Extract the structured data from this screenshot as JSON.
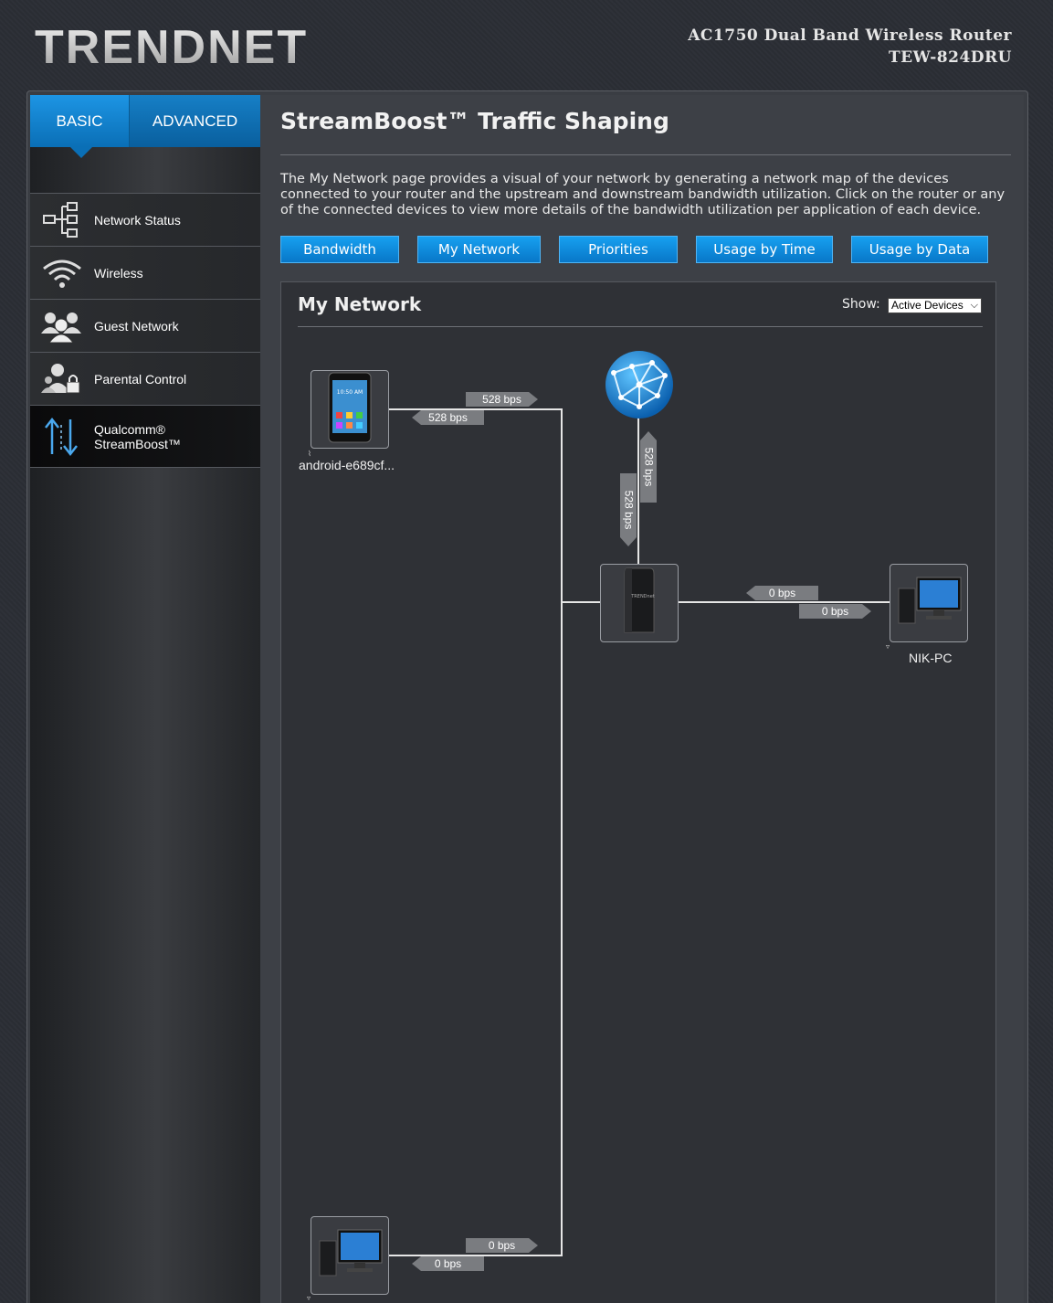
{
  "header": {
    "logo": "TRENDNET",
    "product_name": "AC1750 Dual Band Wireless Router",
    "model": "TEW-824DRU"
  },
  "tabs": [
    {
      "label": "BASIC",
      "active": true
    },
    {
      "label": "ADVANCED",
      "active": false
    }
  ],
  "sidebar": {
    "items": [
      {
        "label": "Network Status",
        "icon": "network-status-icon"
      },
      {
        "label": "Wireless",
        "icon": "wifi-icon"
      },
      {
        "label": "Guest Network",
        "icon": "guest-users-icon"
      },
      {
        "label": "Parental Control",
        "icon": "parental-lock-icon"
      },
      {
        "label_line1": "Qualcomm®",
        "label_line2": "StreamBoost™",
        "icon": "up-down-arrows-icon",
        "active": true
      }
    ]
  },
  "page": {
    "title": "StreamBoost™ Traffic Shaping",
    "description": "The My Network page provides a visual of your network by generating a network map of the devices connected to your router and the upstream and downstream bandwidth utilization. Click on the router or any of the connected devices to view more details of the bandwidth utilization per application of each device."
  },
  "buttons": [
    {
      "label": "Bandwidth"
    },
    {
      "label": "My Network"
    },
    {
      "label": "Priorities"
    },
    {
      "label": "Usage by Time"
    },
    {
      "label": "Usage by Data"
    }
  ],
  "panel": {
    "title": "My Network",
    "show_label": "Show:",
    "show_value": "Active Devices"
  },
  "network": {
    "internet_up": "528 bps",
    "internet_down": "528 bps",
    "devices": [
      {
        "name": "android-e689cf...",
        "up": "528 bps",
        "down": "528 bps"
      },
      {
        "name": "NIK-PC",
        "up": "0 bps",
        "down": "0 bps"
      },
      {
        "name": "",
        "up": "0 bps",
        "down": "0 bps"
      }
    ]
  },
  "colors": {
    "accent": "#1a8fde",
    "background": "#2b2e35",
    "panel": "#2f3136"
  }
}
